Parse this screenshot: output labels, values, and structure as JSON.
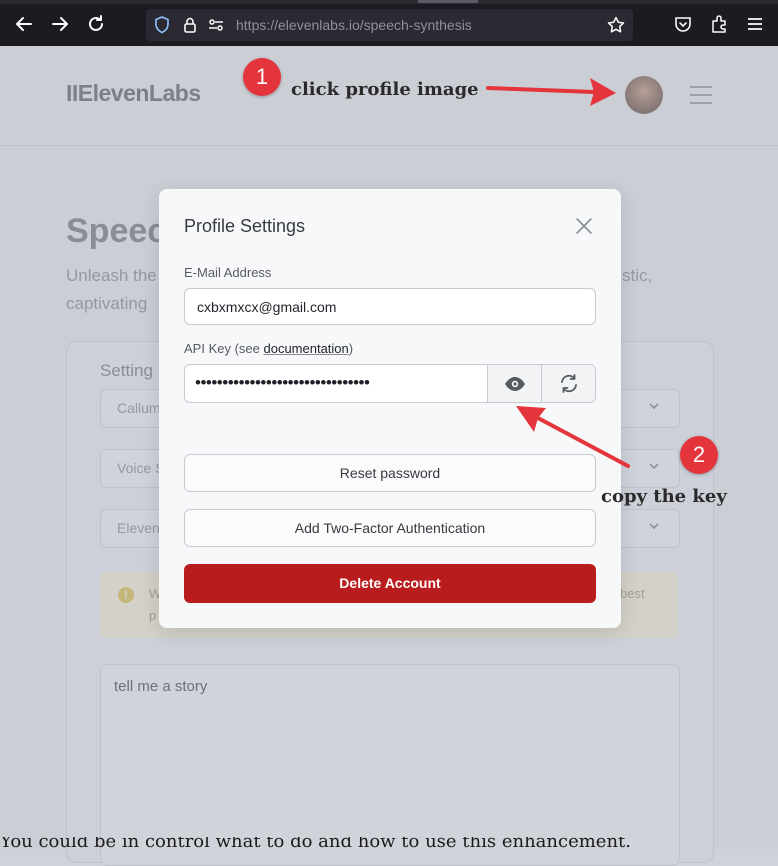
{
  "browser": {
    "url": "https://elevenlabs.io/speech-synthesis",
    "back_icon": "arrow-left-icon",
    "forward_icon": "arrow-right-icon",
    "reload_icon": "reload-icon"
  },
  "site": {
    "logo": "IIElevenLabs",
    "title_fragment": "Speec",
    "subtitle_line1": "Unleash the",
    "subtitle_line2": "captivating",
    "subtitle_right": "stic,",
    "settings_fragment": "Setting",
    "select_1": "Callum",
    "select_2": "Voice S",
    "select_3": "Eleven",
    "warning_line1": "W",
    "warning_line2": "p",
    "warning_right": "best",
    "textarea_value": "tell me a story",
    "bottom_text": "You could be in control what to do and how to use this enhancement."
  },
  "modal": {
    "title": "Profile Settings",
    "email_label": "E-Mail Address",
    "email_value": "cxbxmxcx@gmail.com",
    "apikey_label_prefix": "API Key (see ",
    "apikey_link": "documentation",
    "apikey_label_suffix": ")",
    "apikey_masked": "••••••••••••••••••••••••••••••••",
    "reset_password": "Reset password",
    "two_factor": "Add Two-Factor Authentication",
    "delete_account": "Delete Account"
  },
  "annotations": {
    "step1_number": "1",
    "step1_text": "click profile image",
    "step2_number": "2",
    "step2_text": "copy the key",
    "accent_color": "#e3353b"
  }
}
